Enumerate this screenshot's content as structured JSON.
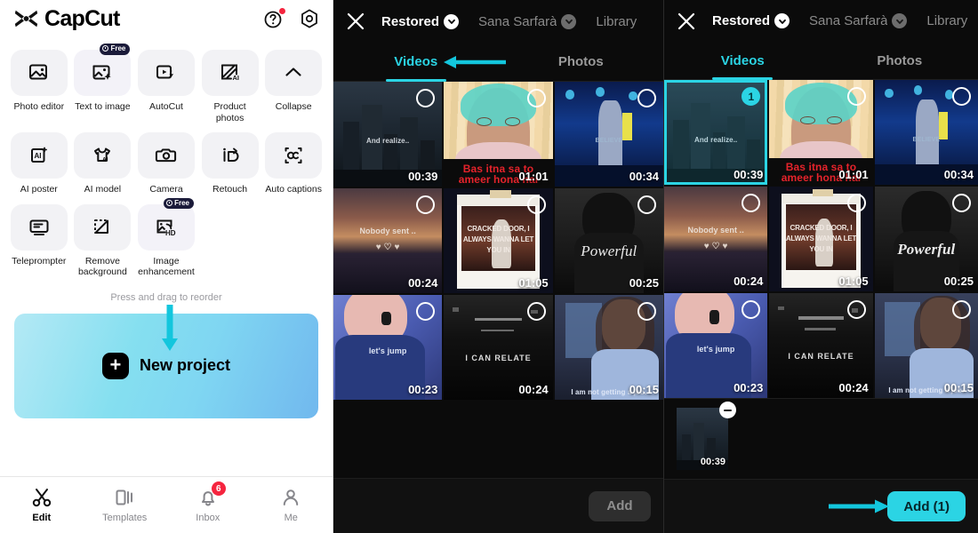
{
  "colors": {
    "accent_cyan": "#2bd4e4",
    "badge_red": "#f5253f",
    "card_grey": "#f2f2f5",
    "free_badge_navy": "#1b1b3a",
    "panel_dark": "#0b0b0b"
  },
  "left_panel": {
    "brand_name": "CapCut",
    "help_icon": "question-mark-circle-icon",
    "settings_icon": "gear-hexagon-icon",
    "tools": [
      {
        "label": "Photo editor",
        "icon": "image-edit-icon",
        "badge": null,
        "tinted": false
      },
      {
        "label": "Text to image",
        "icon": "image-sparkle-icon",
        "badge": "Free",
        "tinted": true
      },
      {
        "label": "AutoCut",
        "icon": "video-bolt-icon",
        "badge": null,
        "tinted": false
      },
      {
        "label": "Product photos",
        "icon": "ai-square-icon",
        "badge": null,
        "tinted": false
      },
      {
        "label": "Collapse",
        "icon": "chevron-up-icon",
        "badge": null,
        "tinted": false
      },
      {
        "label": "AI poster",
        "icon": "ai-poster-icon",
        "badge": null,
        "tinted": false
      },
      {
        "label": "AI model",
        "icon": "tshirt-ai-icon",
        "badge": null,
        "tinted": false
      },
      {
        "label": "Camera",
        "icon": "camera-icon",
        "badge": null,
        "tinted": false
      },
      {
        "label": "Retouch",
        "icon": "retouch-face-icon",
        "badge": null,
        "tinted": false
      },
      {
        "label": "Auto captions",
        "icon": "auto-captions-icon",
        "badge": null,
        "tinted": false
      },
      {
        "label": "Teleprompter",
        "icon": "teleprompter-icon",
        "badge": null,
        "tinted": false
      },
      {
        "label": "Remove background",
        "icon": "remove-background-icon",
        "badge": null,
        "tinted": false
      },
      {
        "label": "Image enhancement",
        "icon": "image-hd-icon",
        "badge": "Free",
        "tinted": true
      }
    ],
    "reorder_hint": "Press and drag to reorder",
    "new_project_label": "New project",
    "nav": [
      {
        "label": "Edit",
        "icon": "scissors-icon",
        "active": true,
        "badge": null
      },
      {
        "label": "Templates",
        "icon": "templates-icon",
        "active": false,
        "badge": null
      },
      {
        "label": "Inbox",
        "icon": "bell-icon",
        "active": false,
        "badge": "6"
      },
      {
        "label": "Me",
        "icon": "person-icon",
        "active": false,
        "badge": null
      }
    ]
  },
  "media_header": {
    "close_icon": "close-x-icon",
    "source_restored": "Restored",
    "source_account": "Sana Sarfarà",
    "source_library": "Library",
    "chevron_icon": "chevron-down-icon"
  },
  "media_tabs": {
    "videos": "Videos",
    "photos": "Photos"
  },
  "mid_panel": {
    "add_label": "Add",
    "add_enabled": false,
    "arrow_videos": "left-arrow-annotation"
  },
  "right_panel": {
    "add_label": "Add (1)",
    "add_enabled": true,
    "arrow_add": "right-arrow-annotation",
    "selected_badge": "1"
  },
  "clips": [
    {
      "duration": "00:39",
      "caption": "And realize..",
      "caption_color": "#cfd4da",
      "caption_size": "8px",
      "scene": "city-skyline-night"
    },
    {
      "duration": "01:01",
      "caption": "Bas itna sa to ameer hona hai",
      "caption_color": "#e5232b",
      "caption_size": "12px",
      "scene": "person-headscarf-portrait"
    },
    {
      "duration": "00:34",
      "caption": "BELIEVE",
      "caption_color": "#9fb6cf",
      "caption_size": "7px",
      "scene": "concert-stage-blue"
    },
    {
      "duration": "00:24",
      "caption": "Nobody sent ..",
      "caption_color": "#e8dcd2",
      "caption_size": "9px",
      "scene": "sunset-ocean"
    },
    {
      "duration": "01:05",
      "caption": "CRACKED DOOR, I ALWAYS WANNA LET YOU IN",
      "caption_color": "#f0e8e2",
      "caption_size": "10px",
      "scene": "instagram-post-song"
    },
    {
      "duration": "00:25",
      "caption": "Powerful",
      "caption_color": "#e9e9e9",
      "caption_size": "17px",
      "scene": "masked-person-dark"
    },
    {
      "duration": "00:23",
      "caption": "let's jump",
      "caption_color": "#dfe6f5",
      "caption_size": "9px",
      "scene": "singer-microphone"
    },
    {
      "duration": "00:24",
      "caption": "I CAN RELATE",
      "caption_color": "#dcdcdc",
      "caption_size": "9px",
      "scene": "night-street-bw"
    },
    {
      "duration": "00:15",
      "caption": "I am not getting a job.",
      "caption_color": "#dfe7f7",
      "caption_size": "8px",
      "scene": "girl-indoor-sweater"
    }
  ],
  "tray": {
    "items": [
      {
        "duration": "00:39",
        "scene": "city-skyline-night",
        "remove_icon": "minus-circle-icon"
      }
    ]
  }
}
